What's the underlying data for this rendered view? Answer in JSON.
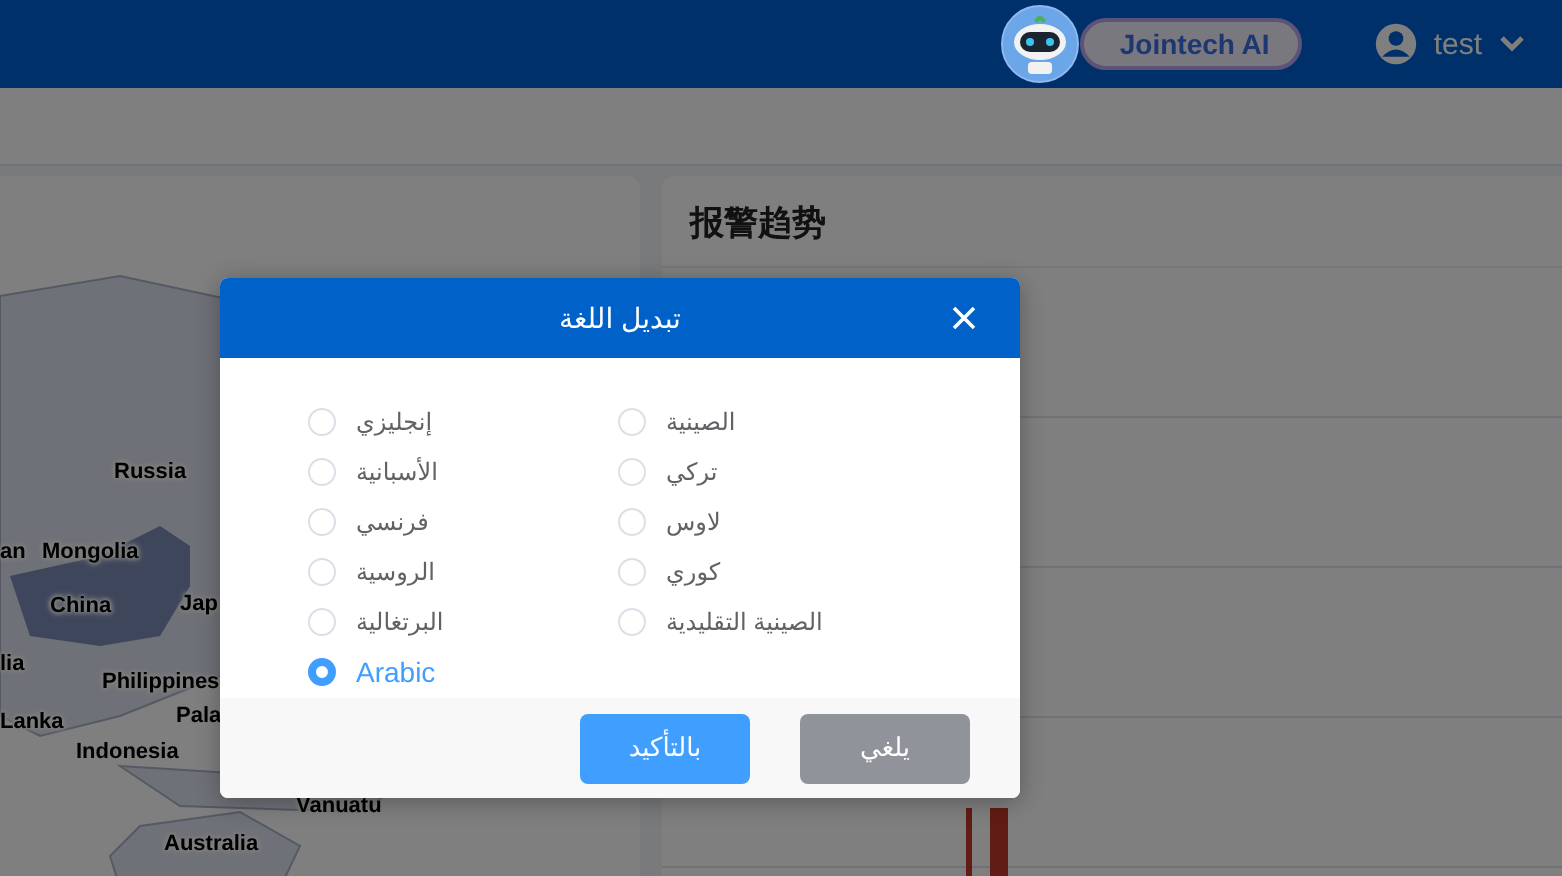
{
  "header": {
    "ai_badge": "Jointech AI",
    "user": "test"
  },
  "alarm_panel": {
    "title": "报警趋势"
  },
  "map": {
    "labels": [
      "Russia",
      "an",
      "Mongolia",
      "China",
      "Jap",
      "lia",
      "Philippines",
      "Lanka",
      "Pala",
      "Indonesia",
      "Vanuatu",
      "Australia"
    ]
  },
  "dialog": {
    "title": "تبديل اللغة",
    "options": [
      {
        "label": "الصينية",
        "selected": false
      },
      {
        "label": "تركي",
        "selected": false
      },
      {
        "label": "لاوس",
        "selected": false
      },
      {
        "label": "كوري",
        "selected": false
      },
      {
        "label": "الصينية التقليدية",
        "selected": false
      },
      {
        "label": "إنجليزي",
        "selected": false
      },
      {
        "label": "الأسبانية",
        "selected": false
      },
      {
        "label": "فرنسي",
        "selected": false
      },
      {
        "label": "الروسية",
        "selected": false
      },
      {
        "label": "البرتغالية",
        "selected": false
      },
      {
        "label": "Arabic",
        "selected": true
      }
    ],
    "confirm": "بالتأكيد",
    "cancel": "يلغي"
  }
}
